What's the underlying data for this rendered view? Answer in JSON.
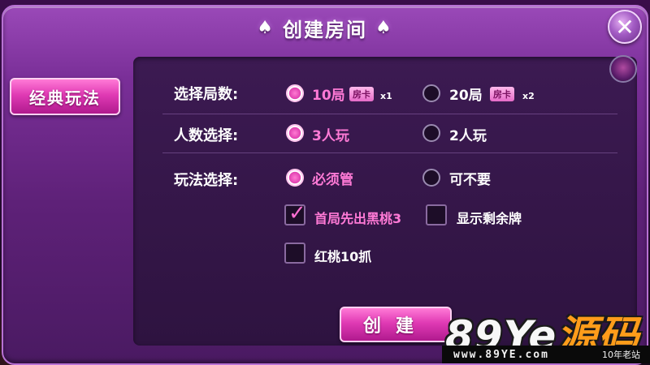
{
  "dialog": {
    "title": "创建房间",
    "close_label": "✕"
  },
  "sidebar": {
    "tab_label": "经典玩法"
  },
  "rounds": {
    "label": "选择局数:",
    "options": [
      {
        "text": "10局",
        "badge": "房卡",
        "multiplier": "x1",
        "selected": true
      },
      {
        "text": "20局",
        "badge": "房卡",
        "multiplier": "x2",
        "selected": false
      }
    ]
  },
  "players": {
    "label": "人数选择:",
    "options": [
      {
        "text": "3人玩",
        "selected": true
      },
      {
        "text": "2人玩",
        "selected": false
      }
    ]
  },
  "play_rules": {
    "label": "玩法选择:",
    "options": [
      {
        "text": "必须管",
        "selected": true
      },
      {
        "text": "可不要",
        "selected": false
      }
    ],
    "checkboxes": [
      {
        "text": "首局先出黑桃3",
        "checked": true
      },
      {
        "text": "显示剩余牌",
        "checked": false
      },
      {
        "text": "红桃10抓",
        "checked": false
      }
    ]
  },
  "actions": {
    "create_label": "创建"
  },
  "watermark": {
    "brand_latin": "89Ye",
    "brand_cn": "源码",
    "url": "www.89YE.com",
    "slogan": "10年老站"
  },
  "colors": {
    "accent_pink": "#ff7ad6",
    "dialog_purple": "#7a2f98",
    "panel_dark": "#2e1340"
  }
}
